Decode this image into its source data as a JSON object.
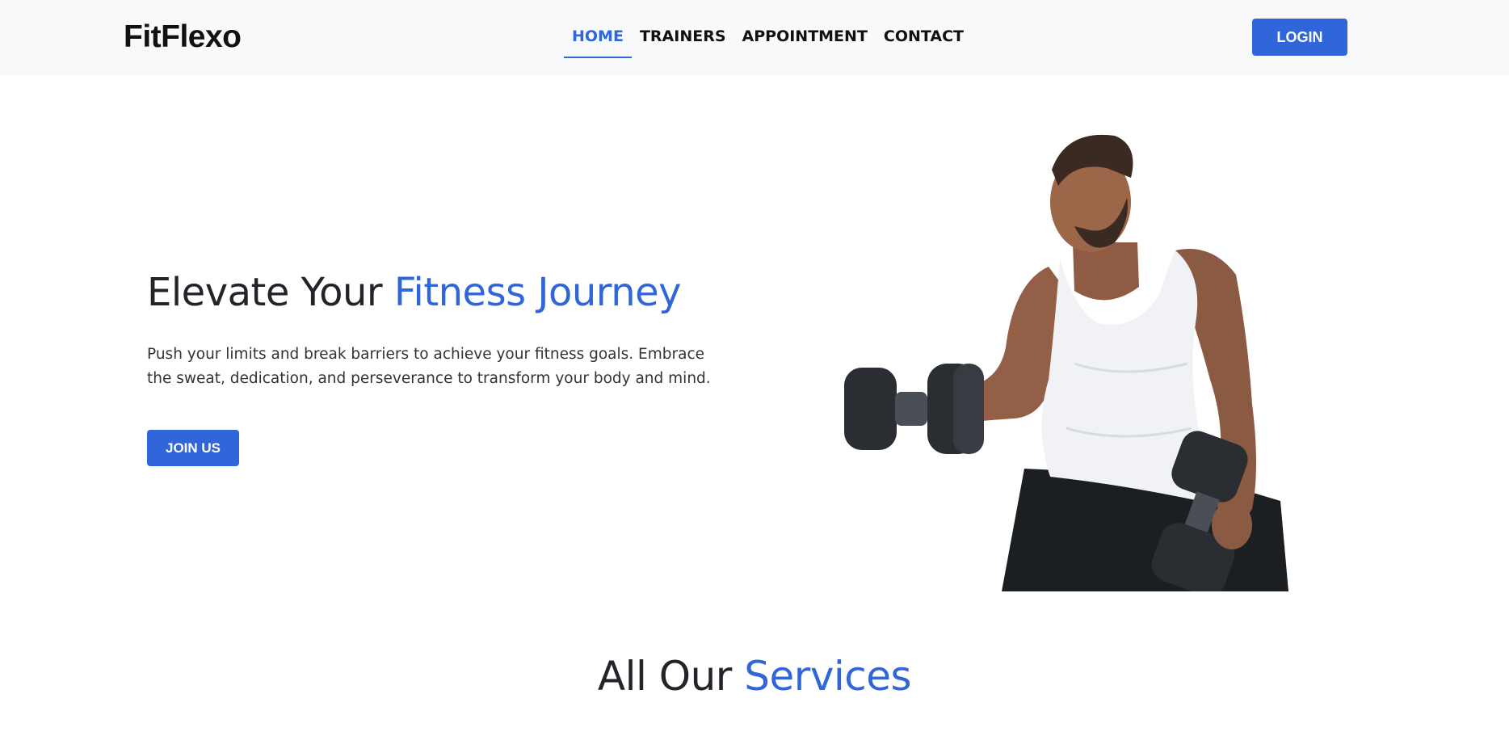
{
  "brand": {
    "name": "FitFlexo"
  },
  "nav": {
    "items": [
      {
        "label": "HOME",
        "active": true
      },
      {
        "label": "TRAINERS",
        "active": false
      },
      {
        "label": "APPOINTMENT",
        "active": false
      },
      {
        "label": "CONTACT",
        "active": false
      }
    ],
    "login_label": "LOGIN"
  },
  "hero": {
    "title_plain": "Elevate Your ",
    "title_accent": "Fitness Journey",
    "text": "Push your limits and break barriers to achieve your fitness goals. Embrace the sweat, dedication, and perseverance to transform your body and mind.",
    "cta_label": "JOIN US",
    "image_icon": "athlete-with-dumbbells-image"
  },
  "services": {
    "title_plain": "All Our ",
    "title_accent": "Services"
  },
  "colors": {
    "accent": "#3066d9",
    "navbar_bg": "#f8f9fa",
    "text_dark": "#212529"
  }
}
